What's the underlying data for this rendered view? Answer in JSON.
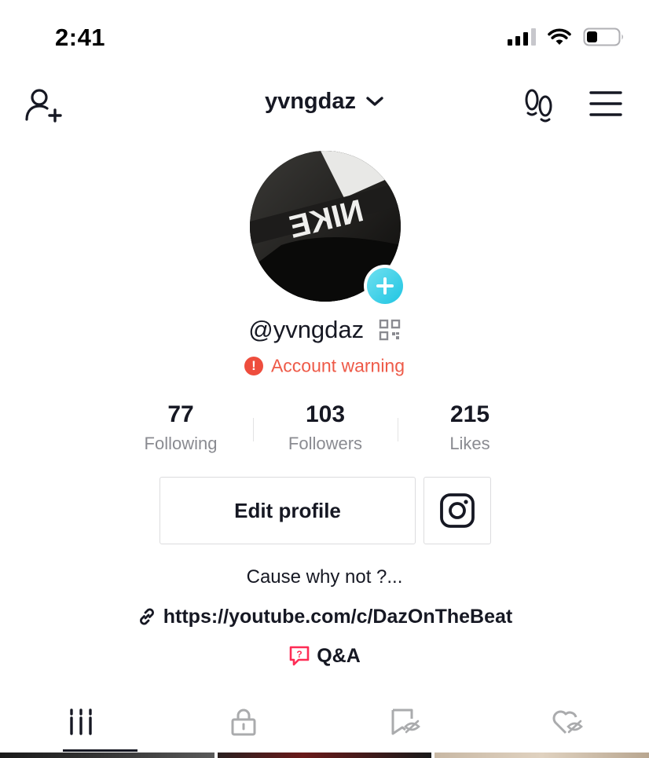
{
  "status_bar": {
    "time": "2:41",
    "signal_bars": 4,
    "signal_bars_active": 3,
    "battery_level": 0.3
  },
  "header": {
    "username": "yvngdaz",
    "icons": {
      "left": "add-user-icon",
      "dropdown": "chevron-down-icon",
      "visitors": "footprints-icon",
      "menu": "hamburger-menu-icon"
    }
  },
  "profile": {
    "avatar_text": "NIKE",
    "handle": "@yvngdaz",
    "account_warning": "Account warning",
    "stats": [
      {
        "value": "77",
        "label": "Following"
      },
      {
        "value": "103",
        "label": "Followers"
      },
      {
        "value": "215",
        "label": "Likes"
      }
    ],
    "edit_profile_label": "Edit profile",
    "bio": "Cause why not ?...",
    "link": "https://youtube.com/c/DazOnTheBeat",
    "qa_label": "Q&A"
  },
  "tabs": [
    {
      "name": "videos",
      "icon": "grid-bars-icon",
      "active": true
    },
    {
      "name": "private",
      "icon": "lock-icon",
      "active": false
    },
    {
      "name": "favorites",
      "icon": "bookmark-hidden-icon",
      "active": false
    },
    {
      "name": "liked",
      "icon": "heart-hidden-icon",
      "active": false
    }
  ],
  "colors": {
    "text": "#161823",
    "secondary": "#8a8b91",
    "warning": "#ee5a48",
    "accent_plus": "#20c5e2",
    "qa_red": "#fe2c55"
  }
}
